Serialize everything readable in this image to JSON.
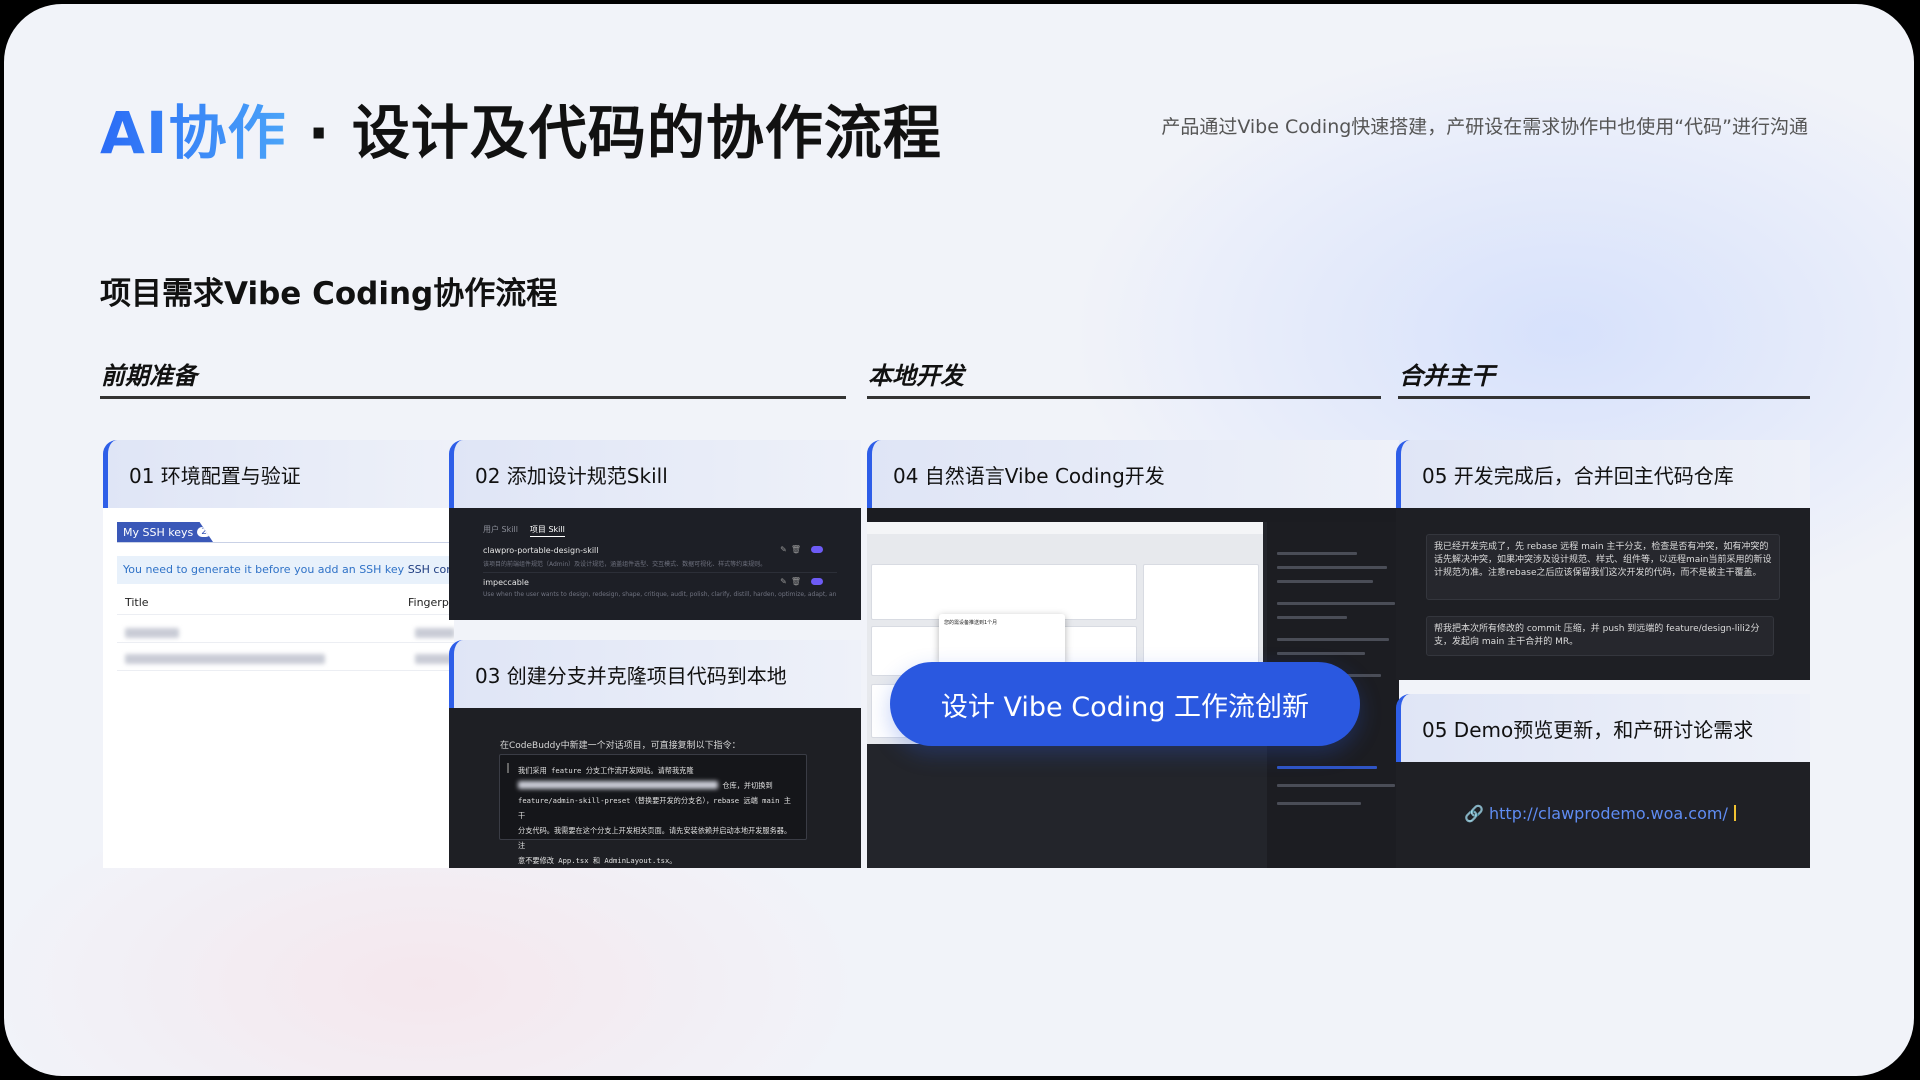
{
  "title": {
    "ai": "AI协作",
    "rest": " · 设计及代码的协作流程"
  },
  "subtitle": "产品通过Vibe Coding快速搭建，产研设在需求协作中也使用“代码”进行沟通",
  "section_title": "项目需求Vibe Coding协作流程",
  "phases": [
    "前期准备",
    "本地开发",
    "合并主干"
  ],
  "cards": {
    "c01": {
      "title": "01  环境配置与验证",
      "tab": "My SSH keys",
      "tab_count": "2",
      "notice": "You need to generate it before you add an SSH key",
      "notice_link": "SSH configuration doc",
      "col_title": "Title",
      "col_fingerprint": "Fingerpri"
    },
    "c02": {
      "title": "02  添加设计规范Skill",
      "tab_a": "用户 Skill",
      "tab_b": "项目 Skill",
      "skill1_name": "clawpro-portable-design-skill",
      "skill1_desc": "该项目的前端组件规范（Admin）及设计规范，涵盖组件选型、交互模式、数据可视化、样式等约束规则。",
      "skill2_name": "impeccable",
      "skill2_desc": "Use when the user wants to design, redesign, shape, critique, audit, polish, clarify, distill, harden, optimize, adapt, animate, ..."
    },
    "c03": {
      "title": "03  创建分支并克隆项目代码到本地",
      "lead": "在CodeBuddy中新建一个对话项目，可直接复制以下指令：",
      "code": [
        "我们采用 feature 分支工作流开发网站。请帮我克隆",
        "仓库，并切换到",
        "feature/admin-skill-preset（替换要开发的分支名），rebase 远端 main 主干",
        "分支代码。我需要在这个分支上开发相关页面。请先安装依赖并启动本地开发服务器。注",
        "意不要修改 App.tsx 和 AdminLayout.tsx。"
      ]
    },
    "c04": {
      "title": "04  自然语言Vibe Coding开发",
      "modal_title": "您的需设备推送到1个月",
      "badge": "设计 Vibe Coding 工作流创新"
    },
    "c05": {
      "title": "05  开发完成后，合并回主代码仓库",
      "msg1": "我已经开发完成了，先 rebase 远程 main 主干分支，检查是否有冲突，如有冲突的话先解决冲突，如果冲突涉及设计规范、样式、组件等，以远程main当前采用的新设计规范为准。注意rebase之后应该保留我们这次开发的代码，而不是被主干覆盖。",
      "msg2": "帮我把本次所有修改的 commit 压缩，并 push 到远端的 feature/design-lili2分支，发起向 main 主干合并的 MR。"
    },
    "c06": {
      "title": "05  Demo预览更新，和产研讨论需求",
      "link_icon": "link-icon",
      "url": "http://clawprodemo.woa.com/"
    }
  },
  "colors": {
    "accent": "#2e5ee8",
    "badge": "#2a58e0",
    "title_gradient": [
      "#2b6cf6",
      "#4aa3f8"
    ]
  }
}
